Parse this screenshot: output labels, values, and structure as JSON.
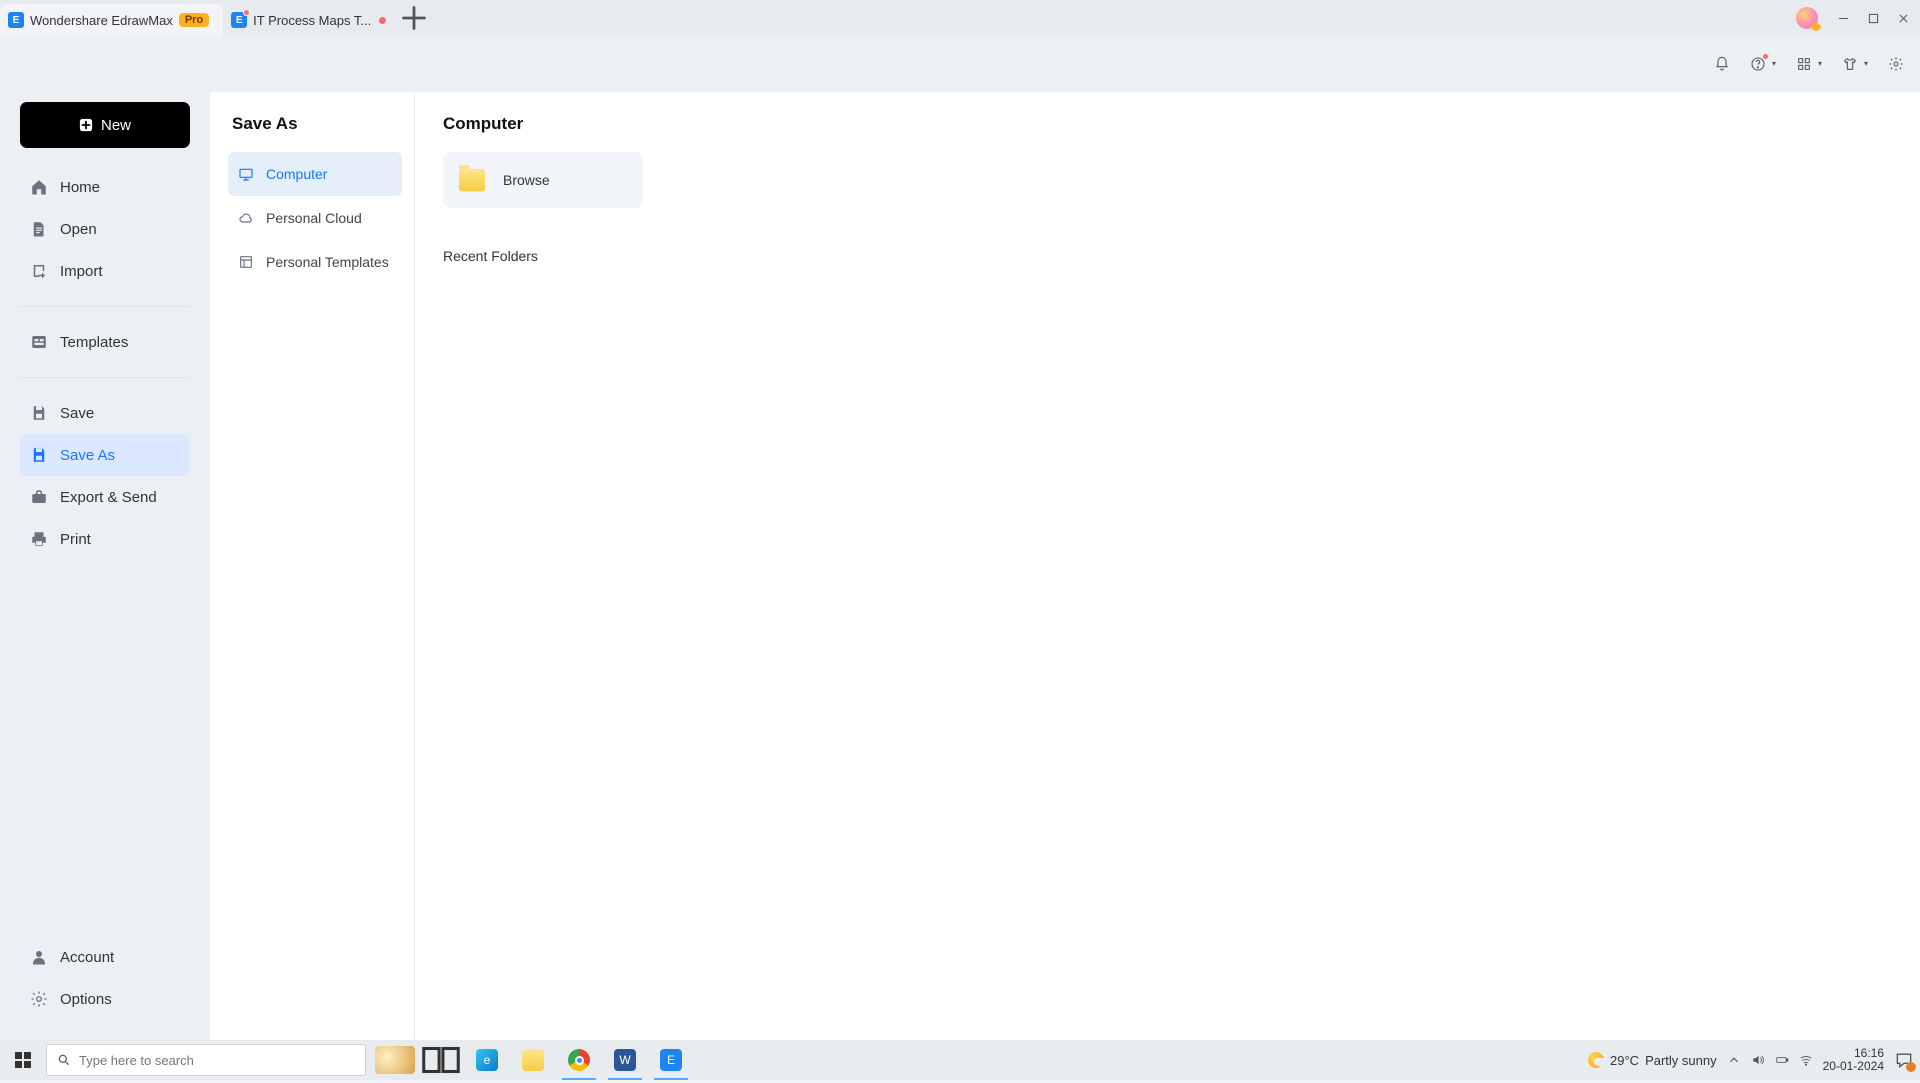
{
  "tabstrip": {
    "main_tab": "Wondershare EdrawMax",
    "pro_badge": "Pro",
    "doc_tab": "IT Process Maps T..."
  },
  "sidebar1": {
    "new_button": "New",
    "group1": [
      "Home",
      "Open",
      "Import"
    ],
    "group2": [
      "Templates"
    ],
    "group3": [
      "Save",
      "Save As",
      "Export & Send",
      "Print"
    ],
    "footer": [
      "Account",
      "Options"
    ],
    "selected": "Save As"
  },
  "sidebar2": {
    "title": "Save As",
    "items": [
      "Computer",
      "Personal Cloud",
      "Personal Templates"
    ],
    "active": "Computer"
  },
  "content": {
    "title": "Computer",
    "browse_label": "Browse",
    "recent_title": "Recent Folders"
  },
  "taskbar": {
    "search_placeholder": "Type here to search",
    "weather_temp": "29°C",
    "weather_desc": "Partly sunny",
    "time": "16:16",
    "date": "20-01-2024"
  }
}
